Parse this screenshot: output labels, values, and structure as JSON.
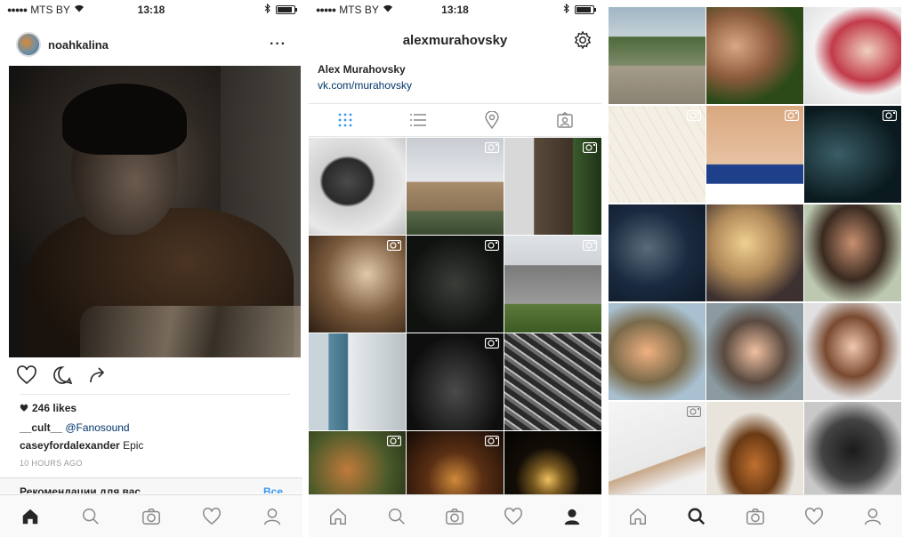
{
  "status_bar": {
    "carrier": "MTS BY",
    "time": "13:18"
  },
  "feed": {
    "username": "noahkalina",
    "likes": "246 likes",
    "comments": [
      {
        "user": "__cult__",
        "text": "@Fanosound"
      },
      {
        "user": "caseyfordalexander",
        "text": "Epic"
      }
    ],
    "time_ago": "10 HOURS AGO",
    "recommendations_label": "Рекомендации для вас",
    "see_all_label": "Все"
  },
  "profile": {
    "title": "alexmurahovsky",
    "name": "Alex Murahovsky",
    "link": "vk.com/murahovsky",
    "tabs": [
      "grid-icon",
      "list-icon",
      "location-pin-icon",
      "tagged-person-icon"
    ]
  },
  "tabbar_icons": [
    "home-icon",
    "search-icon",
    "camera-icon",
    "heart-icon",
    "profile-icon"
  ],
  "colors": {
    "link": "#003569",
    "accent": "#3897f0",
    "active_tab": "#3897f0"
  }
}
